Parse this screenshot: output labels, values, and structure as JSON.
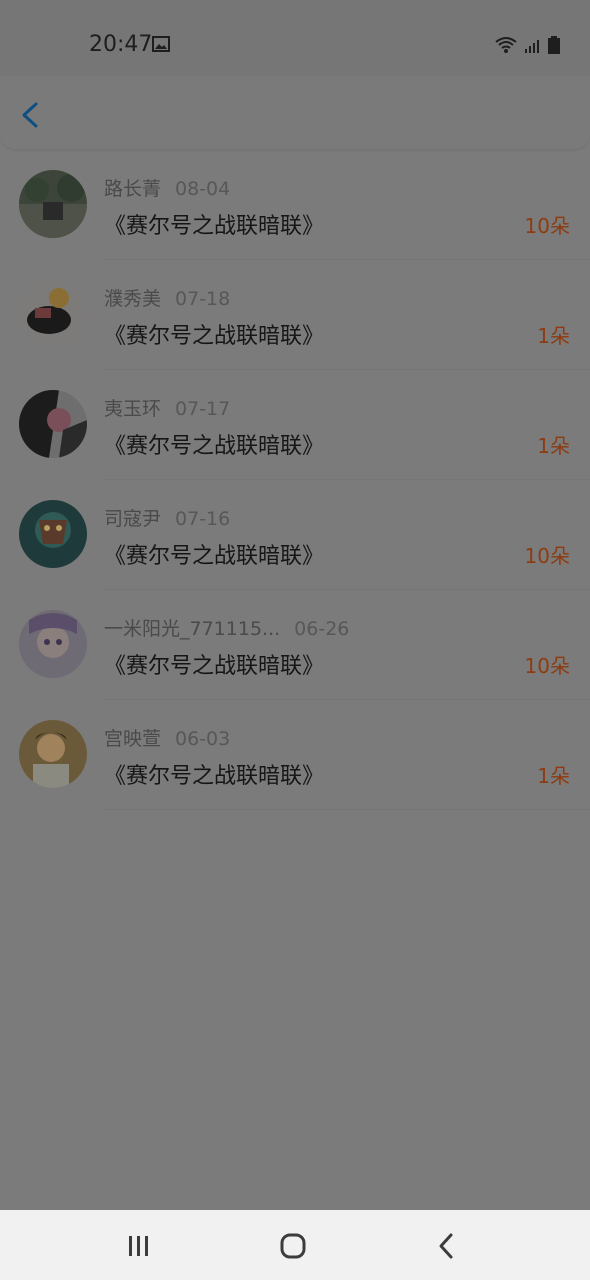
{
  "status_bar": {
    "time": "20:47",
    "icons": [
      "gallery-icon",
      "wifi-icon",
      "signal-icon",
      "battery-icon"
    ]
  },
  "header": {
    "back_icon": "chevron-left-icon"
  },
  "items": [
    {
      "name": "路长菁",
      "date": "08-04",
      "title": "《赛尔号之战联暗联》",
      "amount": "10朵"
    },
    {
      "name": "濮秀美",
      "date": "07-18",
      "title": "《赛尔号之战联暗联》",
      "amount": "1朵"
    },
    {
      "name": "夷玉环",
      "date": "07-17",
      "title": "《赛尔号之战联暗联》",
      "amount": "1朵"
    },
    {
      "name": "司寇尹",
      "date": "07-16",
      "title": "《赛尔号之战联暗联》",
      "amount": "10朵"
    },
    {
      "name": "一米阳光_771115...",
      "date": "06-26",
      "title": "《赛尔号之战联暗联》",
      "amount": "10朵"
    },
    {
      "name": "宫映萱",
      "date": "06-03",
      "title": "《赛尔号之战联暗联》",
      "amount": "1朵"
    }
  ],
  "nav": {
    "icons": [
      "recent-apps-icon",
      "home-icon",
      "back-icon"
    ]
  },
  "colors": {
    "accent_amount": "#8d3b10",
    "overlay": "#7b7b7b"
  }
}
